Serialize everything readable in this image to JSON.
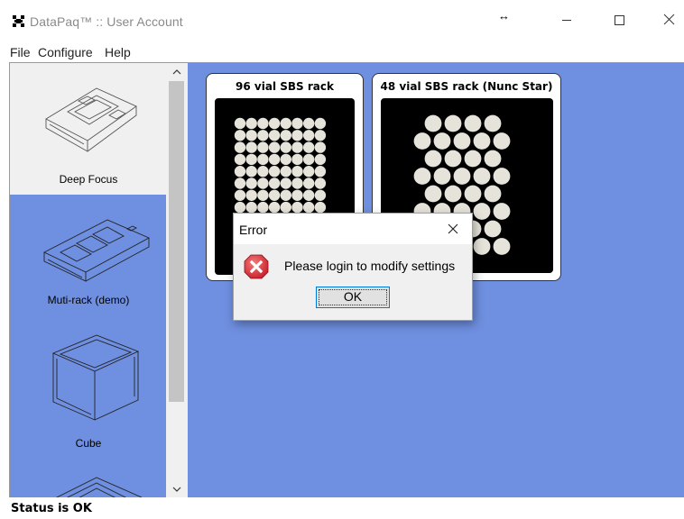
{
  "window": {
    "title": "DataPaq™ :: User Account",
    "app_icon": "datapaq-logo-icon",
    "resize_glyph": "↔",
    "buttons": [
      "minimize-icon",
      "maximize-icon",
      "close-icon"
    ]
  },
  "menu": {
    "items": [
      "File",
      "Configure",
      "Help"
    ]
  },
  "sidebar": {
    "devices": [
      {
        "label": "Deep Focus",
        "selected": true
      },
      {
        "label": "Muti-rack (demo)",
        "selected": false
      },
      {
        "label": "Cube",
        "selected": false
      }
    ]
  },
  "racks": [
    {
      "title": "96 vial SBS rack"
    },
    {
      "title": "48 vial SBS  rack (Nunc Star)"
    }
  ],
  "dialog": {
    "title": "Error",
    "message": "Please login to modify settings",
    "ok_label": "OK",
    "icon": "error-icon"
  },
  "status": {
    "text": "Status is OK"
  },
  "colors": {
    "panel_blue": "#6f8fe0",
    "error_red": "#d9303b",
    "focus_blue": "#0078d7"
  }
}
